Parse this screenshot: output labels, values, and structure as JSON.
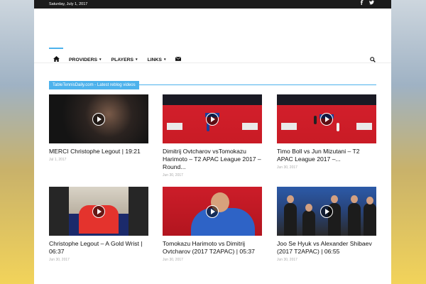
{
  "topbar": {
    "date": "Saturday, July 1, 2017",
    "facebook_icon": "f",
    "twitter_icon": "twitter-bird"
  },
  "nav": {
    "home_icon": "home",
    "items": [
      {
        "label": "PROVIDERS",
        "has_dropdown": true
      },
      {
        "label": "PLAYERS",
        "has_dropdown": true
      },
      {
        "label": "LINKS",
        "has_dropdown": true
      }
    ],
    "mail_icon": "envelope",
    "search_icon": "magnifier"
  },
  "block": {
    "title": "TableTennisDaily.com - Latest reblog videos",
    "accent": "#4db2ec"
  },
  "cards": [
    {
      "title": "MERCI Christophe Legout | 19:21",
      "date": "Jul 1, 2017"
    },
    {
      "title": "Dimitrij Ovtcharov vsTomokazu Harimoto – T2 APAC League 2017 – Round...",
      "date": "Jun 30, 2017"
    },
    {
      "title": "Timo Boll vs Jun Mizutani – T2 APAC League 2017 –...",
      "date": "Jun 30, 2017"
    },
    {
      "title": "Christophe Legout – A Gold Wrist | 06:37",
      "date": "Jun 30, 2017"
    },
    {
      "title": "Tomokazu Harimoto vs Dimitrij Ovtcharov (2017 T2APAC) | 05:37",
      "date": "Jun 30, 2017"
    },
    {
      "title": "Joo Se Hyuk vs Alexander Shibaev (2017 T2APAC) | 06:55",
      "date": "Jun 30, 2017"
    }
  ]
}
